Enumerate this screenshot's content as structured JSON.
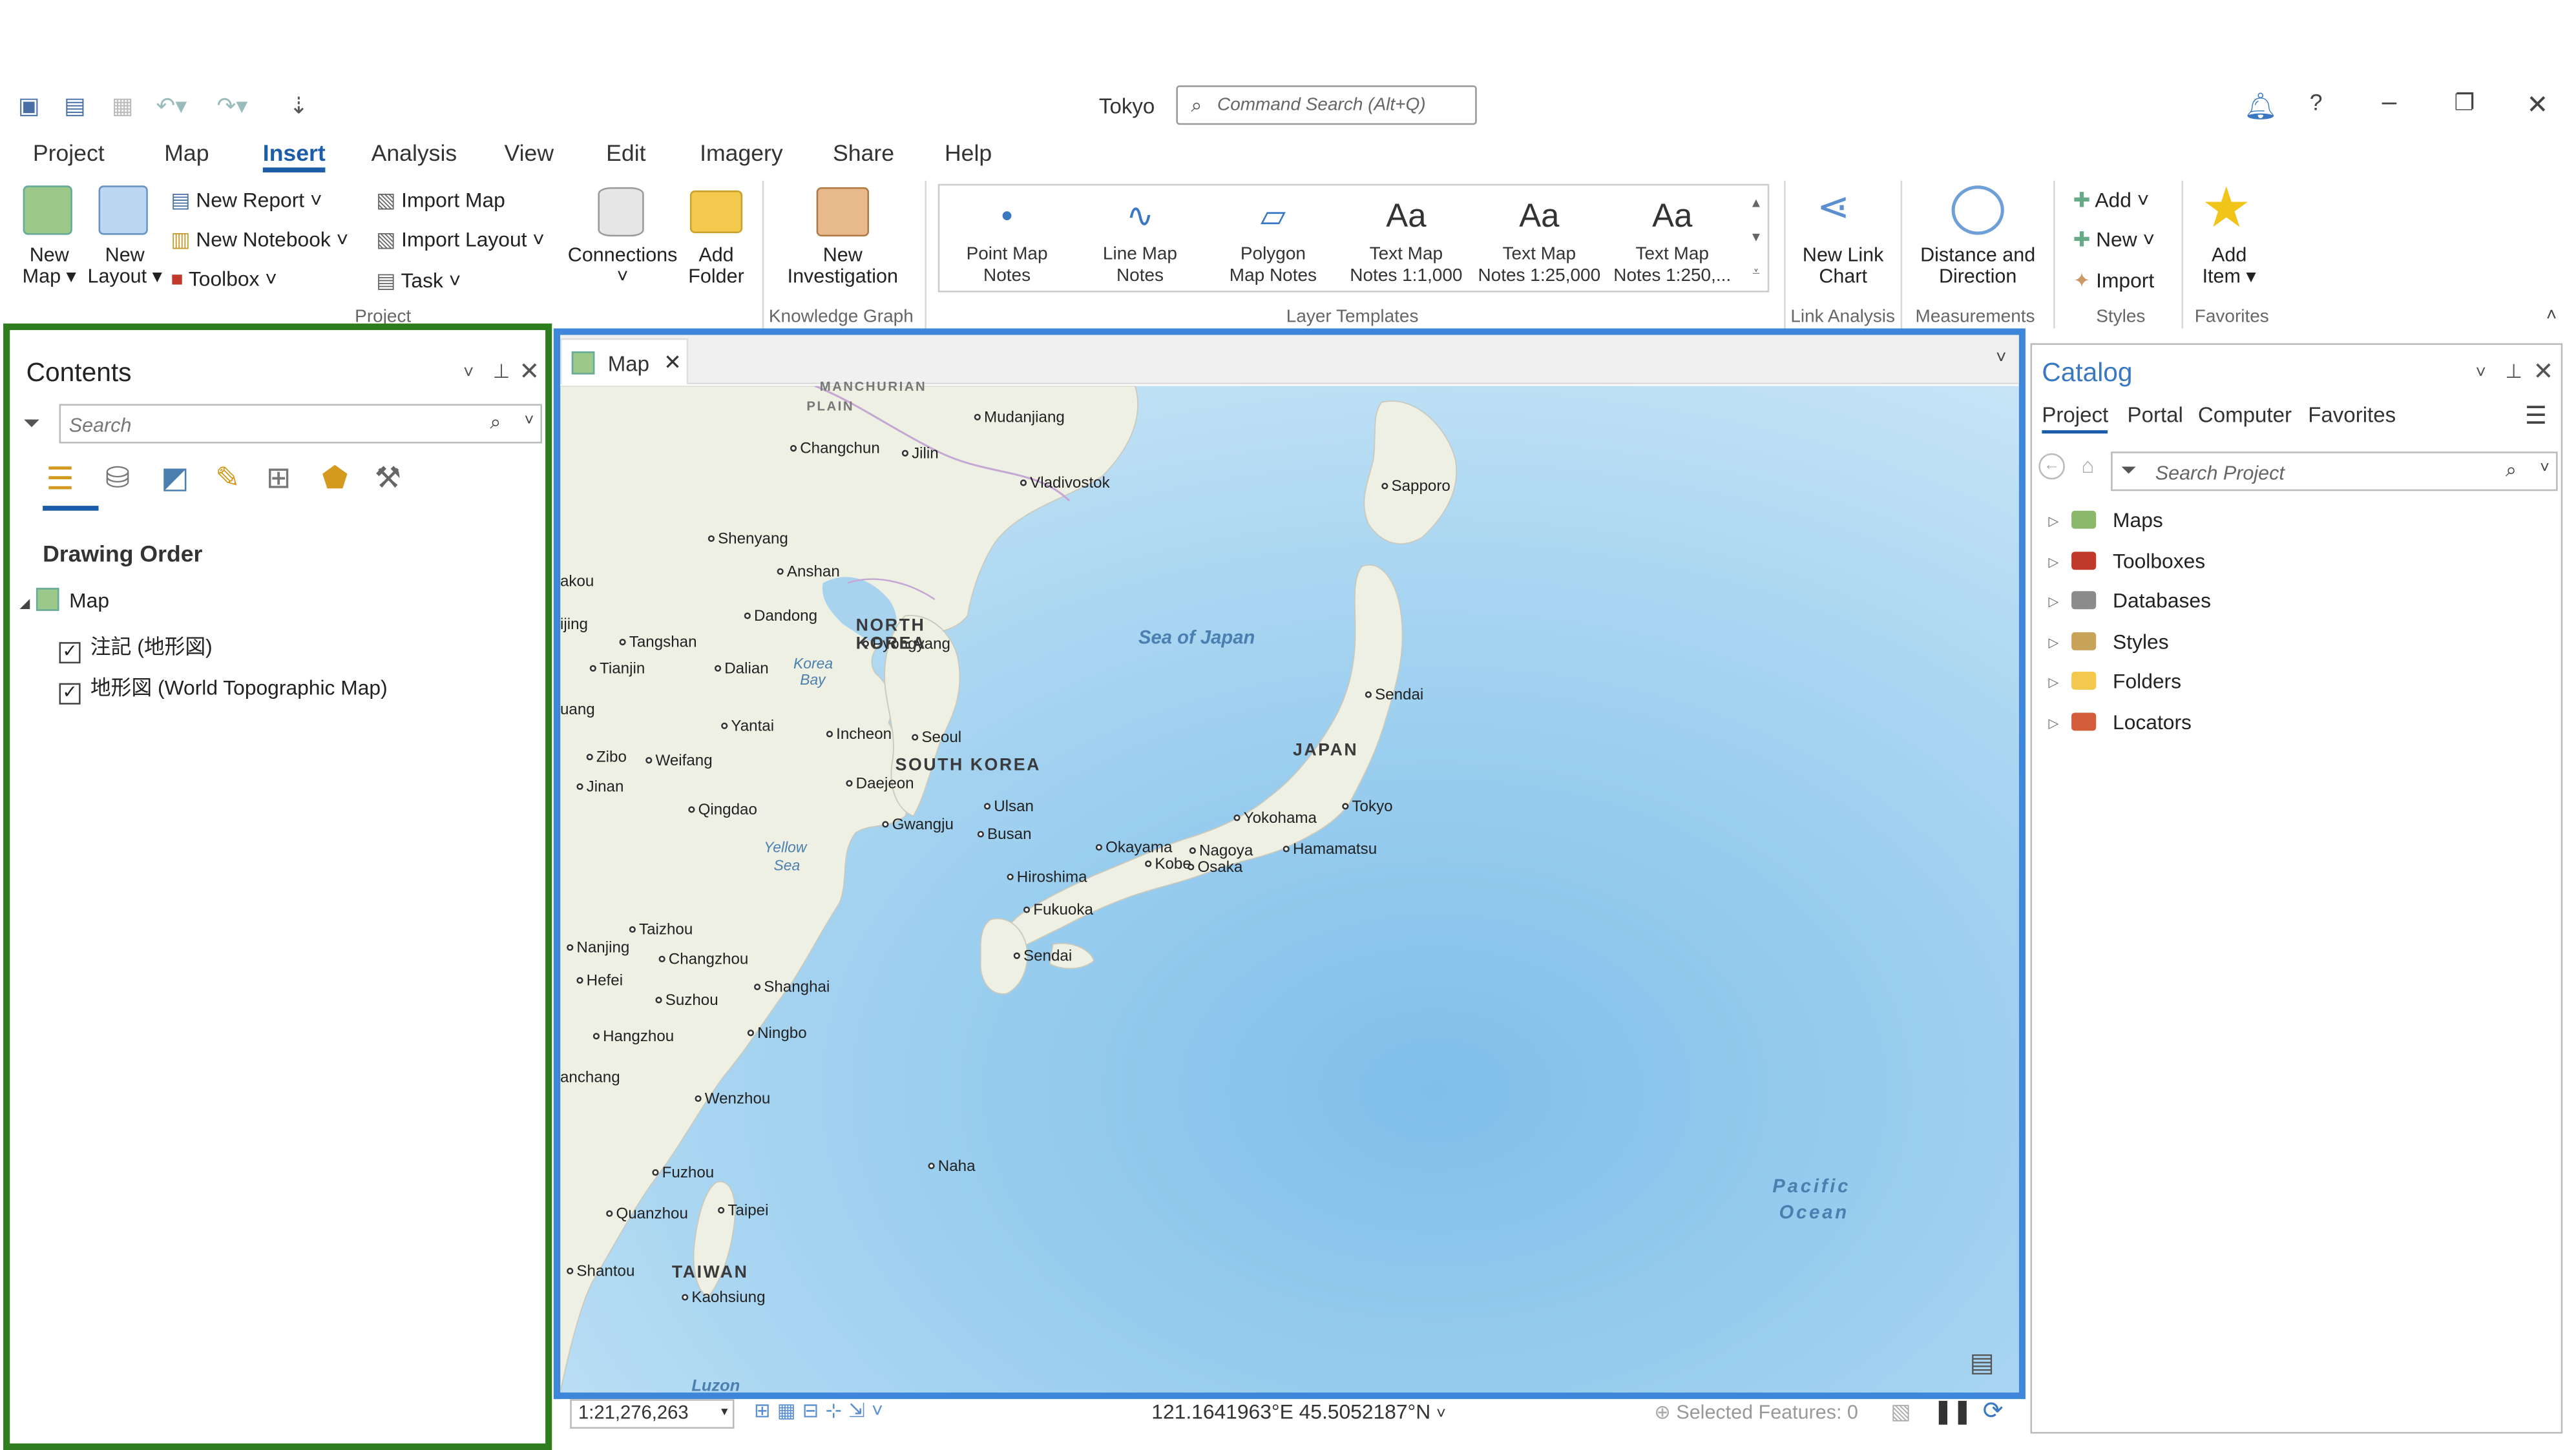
{
  "window": {
    "title": "Tokyo",
    "command_search_placeholder": "Command Search (Alt+Q)"
  },
  "tabs": [
    "Project",
    "Map",
    "Insert",
    "Analysis",
    "View",
    "Edit",
    "Imagery",
    "Share",
    "Help"
  ],
  "active_tab": "Insert",
  "ribbon": {
    "project": {
      "new_map": "New",
      "new_map2": "Map",
      "new_layout": "New",
      "new_layout2": "Layout",
      "new_report": "New Report",
      "new_notebook": "New Notebook",
      "toolbox": "Toolbox",
      "import_map": "Import Map",
      "import_layout": "Import Layout",
      "task": "Task",
      "connections": "Connections",
      "add_folder": "Add",
      "add_folder2": "Folder",
      "group": "Project"
    },
    "knowledge": {
      "new_investigation": "New",
      "new_investigation2": "Investigation",
      "group": "Knowledge Graph"
    },
    "layer_templates": {
      "items": [
        {
          "l1": "Point Map",
          "l2": "Notes",
          "icon": "•"
        },
        {
          "l1": "Line Map",
          "l2": "Notes",
          "icon": "∿"
        },
        {
          "l1": "Polygon",
          "l2": "Map Notes",
          "icon": "▱"
        },
        {
          "l1": "Text Map",
          "l2": "Notes 1:1,000",
          "icon": "Aa"
        },
        {
          "l1": "Text Map",
          "l2": "Notes 1:25,000",
          "icon": "Aa"
        },
        {
          "l1": "Text Map",
          "l2": "Notes 1:250,...",
          "icon": "Aa"
        }
      ],
      "group": "Layer Templates"
    },
    "link": {
      "l1": "New Link",
      "l2": "Chart",
      "group": "Link Analysis"
    },
    "measure": {
      "l1": "Distance and",
      "l2": "Direction",
      "group": "Measurements"
    },
    "styles": {
      "add": "Add",
      "new": "New",
      "import": "Import",
      "group": "Styles"
    },
    "favorites": {
      "l1": "Add",
      "l2": "Item",
      "group": "Favorites"
    }
  },
  "contents": {
    "title": "Contents",
    "search_placeholder": "Search",
    "heading": "Drawing Order",
    "map": "Map",
    "layers": [
      "注記 (地形図)",
      "地形図 (World Topographic Map)"
    ]
  },
  "map_view": {
    "tab": "Map",
    "scale": "1:21,276,263",
    "coords": "121.1641963°E 45.5052187°N",
    "selected": "Selected Features: 0"
  },
  "map_labels": {
    "cities": [
      "Mudanjiang",
      "Changchun",
      "Jilin",
      "Vladivostok",
      "Sapporo",
      "Shenyang",
      "Anshan",
      "Dandong",
      "Pyongyang",
      "Tangshan",
      "Tianjin",
      "Dalian",
      "Incheon",
      "Seoul",
      "Yantai",
      "Zibo",
      "Weifang",
      "Jinan",
      "Qingdao",
      "Daejeon",
      "Ulsan",
      "Gwangju",
      "Busan",
      "Sendai",
      "Yokohama",
      "Tokyo",
      "Nagoya",
      "Hamamatsu",
      "Okayama",
      "Kobe",
      "Osaka",
      "Hiroshima",
      "Fukuoka",
      "Sendai",
      "Taizhou",
      "Nanjing",
      "Changzhou",
      "Hefei",
      "Shanghai",
      "Suzhou",
      "Hangzhou",
      "Ningbo",
      "Wenzhou",
      "Fuzhou",
      "Quanzhou",
      "Taipei",
      "Naha",
      "Shantou",
      "Kaohsiung",
      "akou",
      "uang",
      "anchang",
      "ijing"
    ],
    "countries": [
      "NORTH",
      "KOREA",
      "SOUTH KOREA",
      "JAPAN",
      "TAIWAN",
      "MANCHURIAN",
      "PLAIN"
    ],
    "water": [
      "Sea of Japan",
      "Korea",
      "Bay",
      "Yellow",
      "Sea",
      "Pacific",
      "Ocean",
      "Luzon"
    ]
  },
  "catalog": {
    "title": "Catalog",
    "tabs": [
      "Project",
      "Portal",
      "Computer",
      "Favorites"
    ],
    "search_placeholder": "Search Project",
    "items": [
      "Maps",
      "Toolboxes",
      "Databases",
      "Styles",
      "Folders",
      "Locators"
    ]
  },
  "colors": {
    "accent": "#1b5da8",
    "contents_border": "#2e7d1e",
    "map_border": "#3d86d9",
    "ocean": "#a8d3ef",
    "land": "#eef0e6"
  }
}
